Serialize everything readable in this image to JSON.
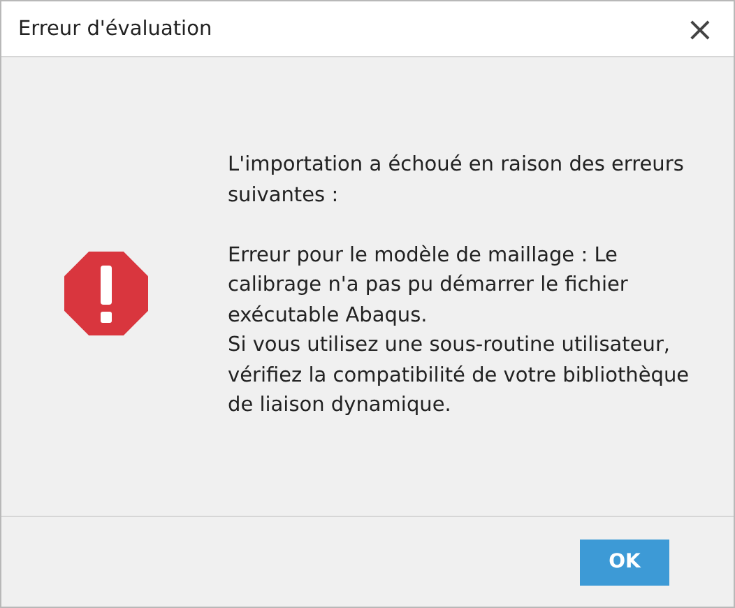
{
  "window": {
    "title": "Erreur d'évaluation",
    "close": "×"
  },
  "message": {
    "heading": "L'importation a échoué en raison des erreurs suivantes :",
    "details": [
      "Erreur pour le modèle de maillage : Le calibrage n'a pas pu démarrer le fichier exécutable Abaqus.",
      "Si vous utilisez une sous-routine utilisateur, vérifiez la compatibilité de votre bibliothèque de liaison dynamique."
    ]
  },
  "buttons": [
    "OK"
  ]
}
